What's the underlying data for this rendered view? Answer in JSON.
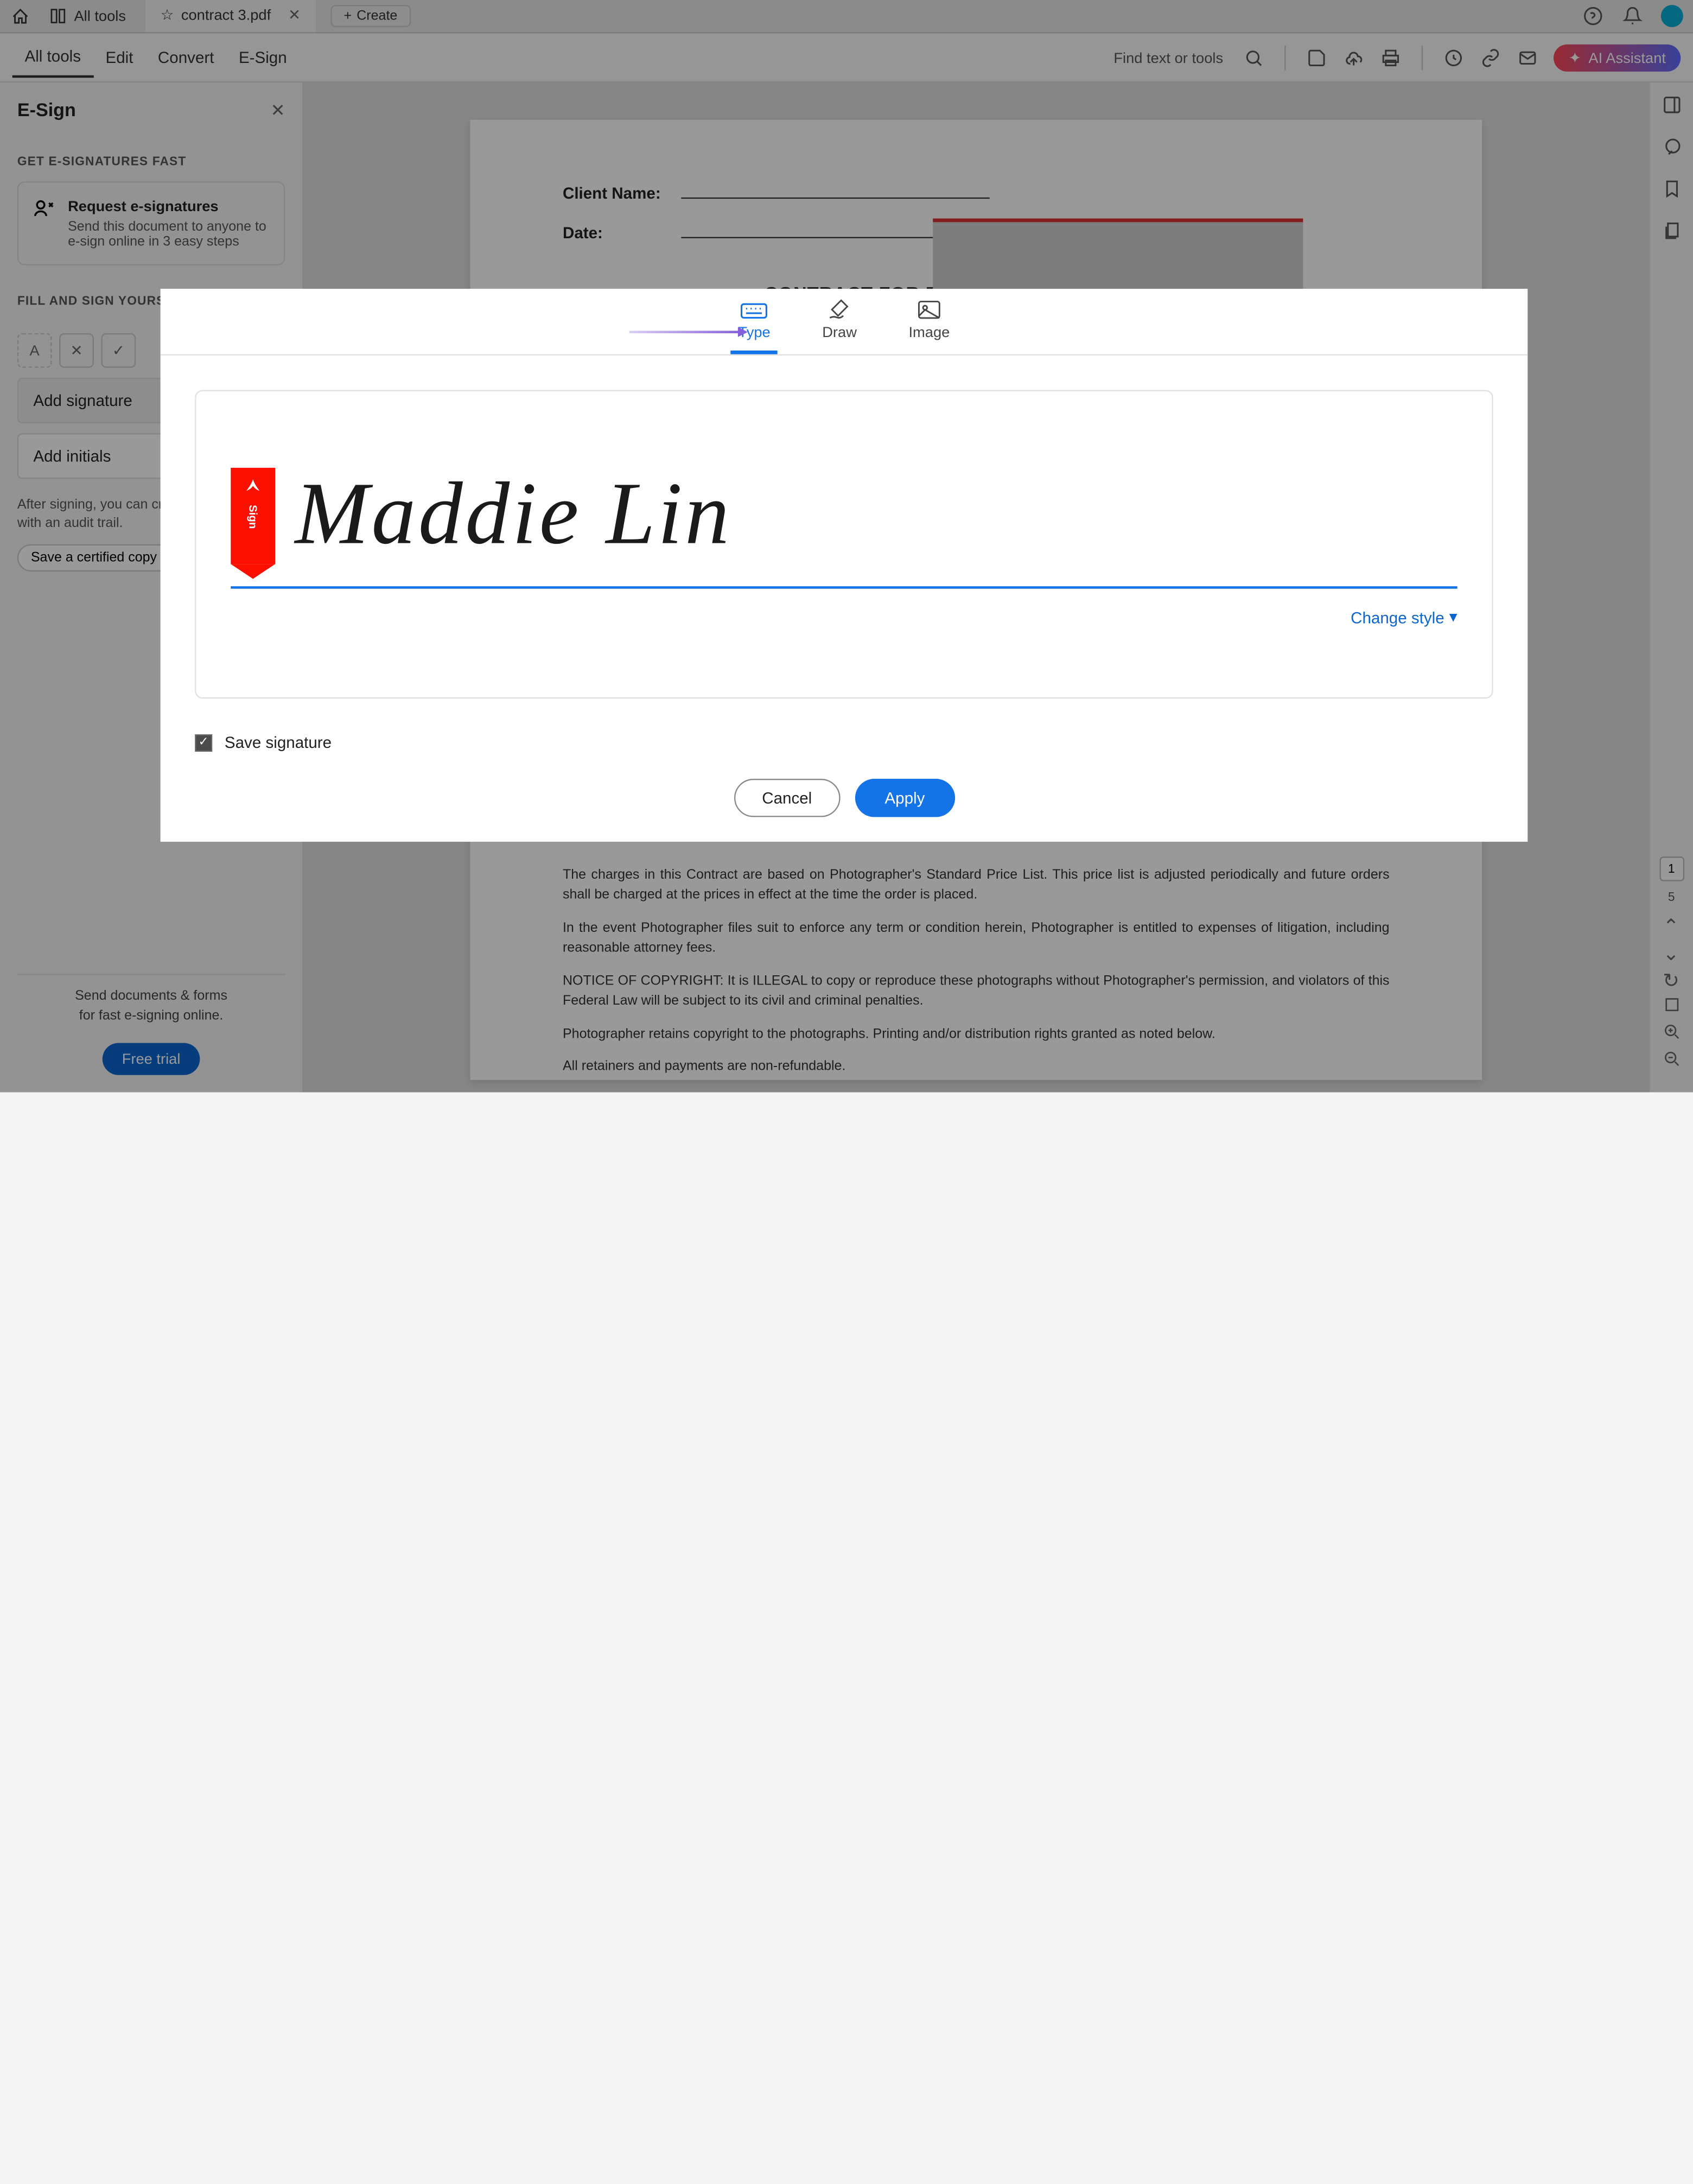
{
  "tabbar": {
    "alltools": "All tools",
    "filename": "contract 3.pdf",
    "create": "Create"
  },
  "menubar": {
    "items": [
      "All tools",
      "Edit",
      "Convert",
      "E-Sign"
    ],
    "find": "Find text or tools",
    "ai": "AI Assistant"
  },
  "sidebar": {
    "title": "E-Sign",
    "section1": "GET E-SIGNATURES FAST",
    "request_title": "Request e-signatures",
    "request_desc": "Send this document to anyone to e-sign online in 3 easy steps",
    "section2": "FILL AND SIGN YOURSELF",
    "add_sig": "Add signature",
    "add_init": "Add initials",
    "cert_text": "After signing, you can create a certified copy with an audit trail.",
    "cert_btn": "Save a certified copy",
    "footer1": "Send documents & forms",
    "footer2": "for fast e-signing online.",
    "trial": "Free trial"
  },
  "document": {
    "client_label": "Client Name:",
    "date_label": "Date:",
    "title": "CONTRACT FOR PHOTOGRAPHIC SERVICES",
    "p1": "The charges in this Contract are based on Photographer's Standard Price List. This price list is adjusted periodically and future orders shall be charged at the prices in effect at the time the order is placed.",
    "p2": "In the event Photographer files suit to enforce any term or condition herein, Photographer is entitled to expenses of litigation, including reasonable attorney fees.",
    "p3": "NOTICE OF COPYRIGHT: It is ILLEGAL to copy or reproduce these photographs without Photographer's permission, and violators of this Federal Law will be subject to its civil and criminal penalties.",
    "p4": "Photographer retains copyright to the photographs. Printing and/or distribution rights granted as noted below.",
    "p5": "All retainers and payments are non-refundable."
  },
  "modal": {
    "tabs": {
      "type": "Type",
      "draw": "Draw",
      "image": "Image"
    },
    "marker": "Sign",
    "signature": "Maddie Lin",
    "change_style": "Change style",
    "save": "Save signature",
    "cancel": "Cancel",
    "apply": "Apply"
  },
  "pagenav": {
    "current": "1",
    "total": "5"
  }
}
